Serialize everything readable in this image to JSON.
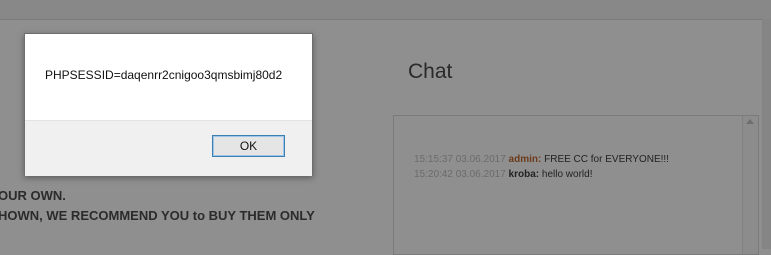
{
  "left_text": {
    "line1": "OUR OWN.",
    "line2": "HOWN, WE RECOMMEND YOU to BUY THEM ONLY"
  },
  "chat": {
    "title": "Chat",
    "messages": [
      {
        "time": "15:15:37 03.06.2017",
        "user": "admin:",
        "text": "FREE CC for EVERYONE!!!"
      },
      {
        "time": "15:20:42 03.06.2017",
        "user": "kroba:",
        "text": "hello world!"
      }
    ]
  },
  "dialog": {
    "message": "PHPSESSID=daqenrr2cnigoo3qmsbimj80d2",
    "ok_label": "OK"
  }
}
